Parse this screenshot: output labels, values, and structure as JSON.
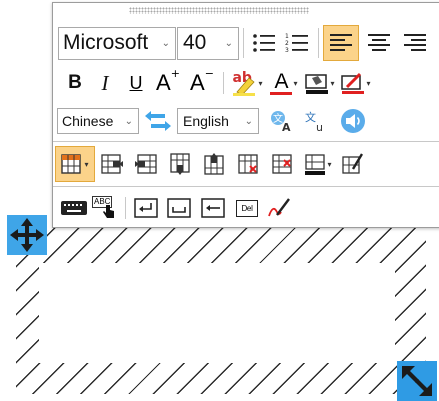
{
  "font": {
    "name": "Microsoft",
    "size": "40"
  },
  "format": {
    "bold": "B",
    "italic": "I",
    "underline": "U",
    "superscript_base": "A",
    "superscript_mark": "+",
    "subscript_base": "A",
    "subscript_mark": "−",
    "highlight_label": "ab",
    "font_color_label": "A"
  },
  "translate": {
    "source_lang": "Chinese",
    "target_lang": "English"
  },
  "keys": {
    "abc_label": "ABC",
    "delete_label": "Del"
  },
  "colors": {
    "accent": "#3fa5e8",
    "active_bg": "#fbd38a",
    "active_border": "#e3a93c",
    "red": "#e02020",
    "green": "#2e9e3a"
  },
  "icons": {
    "row1": [
      "numbered-list-icon",
      "bulleted-list-icon",
      "align-left-icon",
      "align-center-icon",
      "align-right-icon"
    ],
    "row3": [
      "swap-languages-icon",
      "translate-icon",
      "translate-alt-icon",
      "speak-icon"
    ],
    "row4": [
      "table-icon",
      "insert-column-right-icon",
      "insert-column-left-icon",
      "insert-row-below-icon",
      "insert-row-above-icon",
      "delete-column-icon",
      "delete-row-icon",
      "cell-border-icon",
      "table-eraser-icon"
    ],
    "row5": [
      "keyboard-icon",
      "handwriting-abc-icon",
      "enter-key-icon",
      "space-key-icon",
      "backspace-key-icon",
      "delete-key-icon",
      "pen-icon"
    ],
    "handles": [
      "move-handle-icon",
      "resize-handle-icon"
    ]
  }
}
